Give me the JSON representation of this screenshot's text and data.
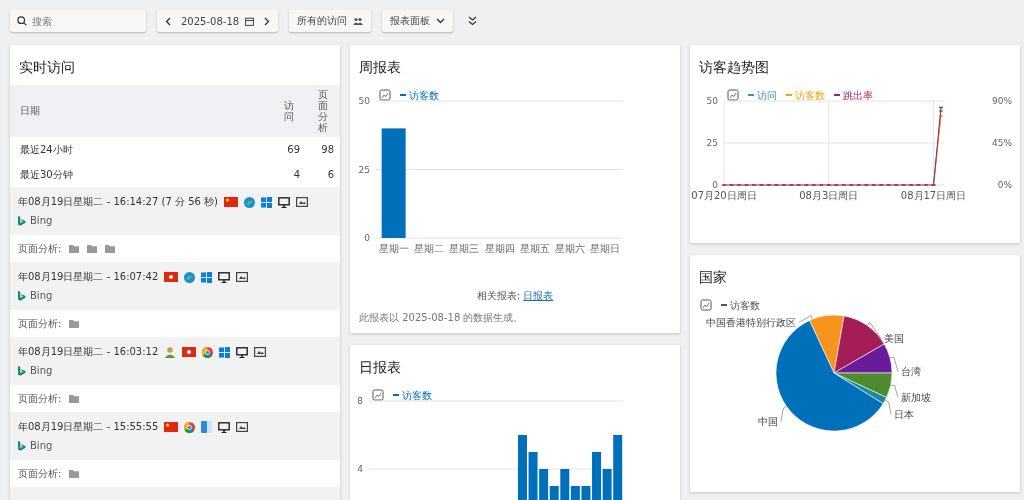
{
  "toolbar": {
    "search": {
      "placeholder": "搜索"
    },
    "date": "2025-08-18",
    "segment_button": "所有的访问",
    "dashboard_button": "报表面板"
  },
  "realtime": {
    "title": "实时访问",
    "columns": [
      "日期",
      "访问",
      "页面分析"
    ],
    "rows": [
      {
        "label": "最近24小时",
        "visits": "69",
        "pageviews": "98"
      },
      {
        "label": "最近30分钟",
        "visits": "4",
        "pageviews": "6"
      }
    ],
    "visits": [
      {
        "time": "年08月19日星期二 - 16:14:27 (7 分 56 秒)",
        "icons": [
          {
            "kind": "flag_cn"
          },
          {
            "kind": "edge"
          },
          {
            "kind": "windows"
          },
          {
            "kind": "desktop"
          },
          {
            "kind": "resolution"
          }
        ],
        "referrer": "Bing",
        "pages_label": "页面分析:",
        "pages": [
          {
            "kind": "folder"
          },
          {
            "kind": "folder"
          },
          {
            "kind": "folder"
          }
        ]
      },
      {
        "time": "年08月19日星期二 - 16:07:42",
        "icons": [
          {
            "kind": "flag_hk"
          },
          {
            "kind": "edge"
          },
          {
            "kind": "windows"
          },
          {
            "kind": "desktop"
          },
          {
            "kind": "resolution"
          }
        ],
        "referrer": "Bing",
        "pages_label": "页面分析:",
        "pages": [
          {
            "kind": "folder"
          }
        ]
      },
      {
        "time": "年08月19日星期二 - 16:03:12",
        "icons": [
          {
            "kind": "user"
          },
          {
            "kind": "flag_hk"
          },
          {
            "kind": "chrome"
          },
          {
            "kind": "windows"
          },
          {
            "kind": "desktop"
          },
          {
            "kind": "resolution"
          }
        ],
        "referrer": "Bing",
        "pages_label": "页面分析:",
        "pages": [
          {
            "kind": "folder"
          }
        ]
      },
      {
        "time": "年08月19日星期二 - 15:55:55",
        "icons": [
          {
            "kind": "flag_cn"
          },
          {
            "kind": "chrome"
          },
          {
            "kind": "mac"
          },
          {
            "kind": "desktop"
          },
          {
            "kind": "resolution"
          }
        ],
        "referrer": "Bing",
        "pages_label": "页面分析:",
        "pages": [
          {
            "kind": "folder"
          }
        ]
      }
    ]
  },
  "weekly": {
    "title": "周报表",
    "chart_data": {
      "type": "bar",
      "categories": [
        "星期一",
        "星期二",
        "星期三",
        "星期四",
        "星期五",
        "星期六",
        "星期日"
      ],
      "ylim": [
        0,
        50
      ],
      "yticks": [
        0,
        25,
        50
      ],
      "series": [
        {
          "name": "访客数",
          "color": "#0070bb",
          "values": [
            40,
            0,
            0,
            0,
            0,
            0,
            0
          ]
        }
      ]
    },
    "related_label": "相关报表:",
    "related_link": "日报表",
    "note": "此报表以 2025-08-18 的数据生成。"
  },
  "daily": {
    "title": "日报表",
    "chart_data": {
      "type": "bar",
      "ylim": [
        0,
        8
      ],
      "yticks": [
        4,
        8
      ],
      "series": [
        {
          "name": "访客数",
          "color": "#0070bb",
          "values": [
            0,
            0,
            0,
            0,
            0,
            0,
            0,
            0,
            0,
            0,
            0,
            0,
            0,
            0,
            6,
            5,
            4,
            3,
            4,
            3,
            3,
            5,
            4,
            6
          ]
        }
      ]
    }
  },
  "trend": {
    "title": "访客趋势图",
    "chart_data": {
      "type": "line",
      "categories": [
        "07月20日周日",
        null,
        null,
        null,
        null,
        null,
        null,
        null,
        null,
        null,
        null,
        null,
        null,
        null,
        "08月3日周日",
        null,
        null,
        null,
        null,
        null,
        null,
        null,
        null,
        null,
        null,
        null,
        null,
        null,
        "08月17日周日",
        null
      ],
      "ylim": [
        0,
        50
      ],
      "yticks": [
        0,
        25,
        50
      ],
      "y2lim": [
        0,
        90
      ],
      "grid": true,
      "legend": "top",
      "y2ticks": [
        {
          "value": 0,
          "label": "0%"
        },
        {
          "value": 45,
          "label": "45%"
        },
        {
          "value": 90,
          "label": "90%"
        }
      ],
      "series": [
        {
          "name": "访问",
          "color": "#3a8fb7",
          "marker": "square",
          "values": [
            null,
            null,
            null,
            null,
            null,
            null,
            null,
            null,
            null,
            null,
            null,
            null,
            null,
            null,
            null,
            null,
            null,
            null,
            null,
            null,
            null,
            null,
            null,
            null,
            null,
            null,
            null,
            null,
            0,
            44
          ]
        },
        {
          "name": "访客数",
          "color": "#f0a30a",
          "marker": "square",
          "values": [
            null,
            null,
            null,
            null,
            null,
            null,
            null,
            null,
            null,
            null,
            null,
            null,
            null,
            null,
            null,
            null,
            null,
            null,
            null,
            null,
            null,
            null,
            null,
            null,
            null,
            null,
            null,
            null,
            0,
            41
          ]
        },
        {
          "name": "跳出率",
          "color": "#a3245c",
          "axis": "y2",
          "marker": "square",
          "values": [
            0,
            0,
            0,
            0,
            0,
            0,
            0,
            0,
            0,
            0,
            0,
            0,
            0,
            0,
            0,
            0,
            0,
            0,
            0,
            0,
            0,
            0,
            0,
            0,
            0,
            0,
            0,
            0,
            0,
            83
          ]
        }
      ]
    }
  },
  "countries": {
    "title": "国家",
    "legend": "访客数",
    "labels": [
      "中国香港特别行政区",
      "美国",
      "台湾",
      "新加坡",
      "日本",
      "中国"
    ]
  }
}
